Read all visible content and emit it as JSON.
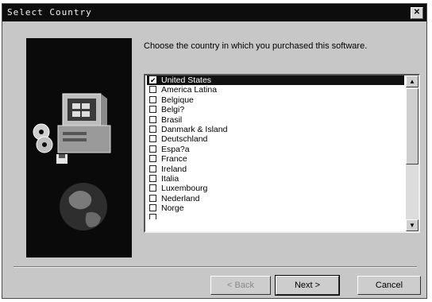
{
  "window": {
    "title": "Select Country",
    "close_symbol": "✕"
  },
  "prompt": "Choose the country in which you purchased this software.",
  "countries": [
    {
      "label": "United States",
      "checked": true,
      "selected": true
    },
    {
      "label": "America Latina",
      "checked": false
    },
    {
      "label": "Belgique",
      "checked": false
    },
    {
      "label": "Belgi?",
      "checked": false
    },
    {
      "label": "Brasil",
      "checked": false
    },
    {
      "label": "Danmark & Island",
      "checked": false
    },
    {
      "label": "Deutschland",
      "checked": false
    },
    {
      "label": "Espa?a",
      "checked": false
    },
    {
      "label": "France",
      "checked": false
    },
    {
      "label": "Ireland",
      "checked": false
    },
    {
      "label": "Italia",
      "checked": false
    },
    {
      "label": "Luxembourg",
      "checked": false
    },
    {
      "label": "Nederland",
      "checked": false
    },
    {
      "label": "Norge",
      "checked": false
    }
  ],
  "buttons": {
    "back": "< Back",
    "next": "Next >",
    "cancel": "Cancel"
  },
  "icons": {
    "check": "✔",
    "scroll_up": "▲",
    "scroll_down": "▼"
  }
}
